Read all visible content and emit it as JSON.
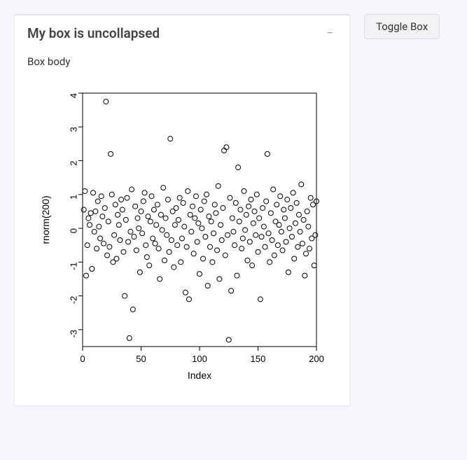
{
  "box": {
    "title": "My box is uncollapsed",
    "body_text": "Box body",
    "collapse_glyph": "−"
  },
  "buttons": {
    "toggle": "Toggle Box"
  },
  "chart_data": {
    "type": "scatter",
    "title": "",
    "xlabel": "Index",
    "ylabel": "rnorm(200)",
    "xlim": [
      0,
      200
    ],
    "ylim": [
      -3.5,
      4
    ],
    "x_ticks": [
      0,
      50,
      100,
      150,
      200
    ],
    "y_ticks": [
      -3,
      -2,
      -1,
      0,
      1,
      2,
      3,
      4
    ],
    "n": 200,
    "series": [
      {
        "name": "rnorm(200)",
        "x": [
          1,
          2,
          3,
          4,
          5,
          6,
          7,
          8,
          9,
          10,
          11,
          12,
          13,
          14,
          15,
          16,
          17,
          18,
          19,
          20,
          21,
          22,
          23,
          24,
          25,
          26,
          27,
          28,
          29,
          30,
          31,
          32,
          33,
          34,
          35,
          36,
          37,
          38,
          39,
          40,
          41,
          42,
          43,
          44,
          45,
          46,
          47,
          48,
          49,
          50,
          51,
          52,
          53,
          54,
          55,
          56,
          57,
          58,
          59,
          60,
          61,
          62,
          63,
          64,
          65,
          66,
          67,
          68,
          69,
          70,
          71,
          72,
          73,
          74,
          75,
          76,
          77,
          78,
          79,
          80,
          81,
          82,
          83,
          84,
          85,
          86,
          87,
          88,
          89,
          90,
          91,
          92,
          93,
          94,
          95,
          96,
          97,
          98,
          99,
          100,
          101,
          102,
          103,
          104,
          105,
          106,
          107,
          108,
          109,
          110,
          111,
          112,
          113,
          114,
          115,
          116,
          117,
          118,
          119,
          120,
          121,
          122,
          123,
          124,
          125,
          126,
          127,
          128,
          129,
          130,
          131,
          132,
          133,
          134,
          135,
          136,
          137,
          138,
          139,
          140,
          141,
          142,
          143,
          144,
          145,
          146,
          147,
          148,
          149,
          150,
          151,
          152,
          153,
          154,
          155,
          156,
          157,
          158,
          159,
          160,
          161,
          162,
          163,
          164,
          165,
          166,
          167,
          168,
          169,
          170,
          171,
          172,
          173,
          174,
          175,
          176,
          177,
          178,
          179,
          180,
          181,
          182,
          183,
          184,
          185,
          186,
          187,
          188,
          189,
          190,
          191,
          192,
          193,
          194,
          195,
          196,
          197,
          198,
          199,
          200
        ],
        "y": [
          0.55,
          1.1,
          -1.4,
          -0.5,
          0.3,
          0.1,
          0.45,
          -1.2,
          1.05,
          -0.1,
          0.5,
          -0.6,
          0.8,
          0.05,
          -0.3,
          0.95,
          0.35,
          -0.45,
          0.6,
          3.75,
          -0.8,
          0.2,
          -0.55,
          2.2,
          1.0,
          -1.0,
          -0.2,
          0.7,
          -0.9,
          0.4,
          0.1,
          -0.35,
          0.85,
          0.55,
          -0.7,
          -2.0,
          0.25,
          0.9,
          -0.4,
          -3.25,
          -0.1,
          1.15,
          -2.4,
          -0.25,
          0.65,
          -0.65,
          0.3,
          0.0,
          -1.3,
          0.5,
          -0.15,
          0.8,
          1.05,
          -0.5,
          -0.85,
          0.35,
          -1.1,
          0.2,
          0.95,
          -0.3,
          0.55,
          -0.45,
          0.1,
          0.7,
          -0.6,
          -1.5,
          0.4,
          -0.05,
          1.2,
          -0.95,
          0.3,
          -0.2,
          0.85,
          -0.7,
          2.65,
          -0.35,
          0.5,
          -1.15,
          0.1,
          0.6,
          -0.5,
          0.25,
          0.9,
          -1.0,
          -0.3,
          0.75,
          0.05,
          -1.9,
          -0.55,
          1.1,
          -2.1,
          0.4,
          -0.1,
          0.65,
          -0.75,
          0.3,
          0.95,
          -0.4,
          0.15,
          -1.35,
          0.55,
          0.0,
          -0.9,
          0.8,
          -0.25,
          1.0,
          -1.7,
          0.35,
          -0.55,
          0.2,
          -1.0,
          -0.15,
          0.7,
          0.45,
          -0.65,
          1.25,
          -1.5,
          0.1,
          -0.35,
          0.6,
          2.3,
          -0.8,
          2.4,
          -0.2,
          -3.3,
          0.9,
          -1.85,
          0.3,
          -0.1,
          -0.5,
          0.75,
          -1.4,
          1.8,
          0.2,
          0.55,
          -0.6,
          -0.3,
          1.1,
          -0.05,
          0.4,
          -0.95,
          0.65,
          -0.4,
          0.85,
          -1.1,
          0.15,
          0.5,
          -0.2,
          1.0,
          -0.7,
          0.3,
          -2.1,
          -0.25,
          0.6,
          0.05,
          -0.55,
          0.8,
          2.2,
          -0.15,
          -1.0,
          0.45,
          -0.35,
          1.15,
          -0.8,
          0.2,
          0.7,
          -0.5,
          0.1,
          0.95,
          -0.1,
          -0.65,
          0.55,
          0.3,
          -0.4,
          0.85,
          -1.3,
          0.0,
          0.6,
          -0.25,
          1.05,
          -0.9,
          0.15,
          0.75,
          -0.55,
          0.4,
          -0.1,
          1.3,
          -0.45,
          0.25,
          -1.4,
          -0.75,
          0.5,
          0.05,
          -0.6,
          0.9,
          -0.3,
          0.7,
          -1.1,
          -0.2,
          0.8
        ]
      }
    ]
  }
}
